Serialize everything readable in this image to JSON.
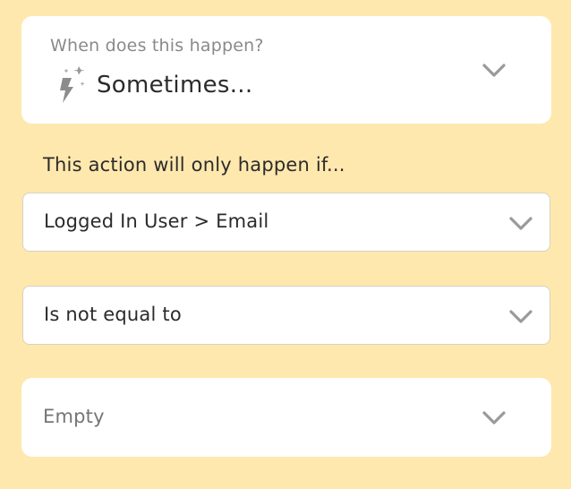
{
  "trigger": {
    "label": "When does this happen?",
    "value": "Sometimes...",
    "icon": "sparkle-lightning-icon"
  },
  "condition": {
    "intro": "This action will only happen if...",
    "field": "Logged In User > Email",
    "operator": "Is not equal to",
    "value_placeholder": "Empty"
  },
  "colors": {
    "background": "#FFE8AE",
    "card": "#FFFFFF",
    "chevron": "#9A9A9A",
    "text": "#2B2B2B",
    "muted_text": "#8A8A8A"
  }
}
